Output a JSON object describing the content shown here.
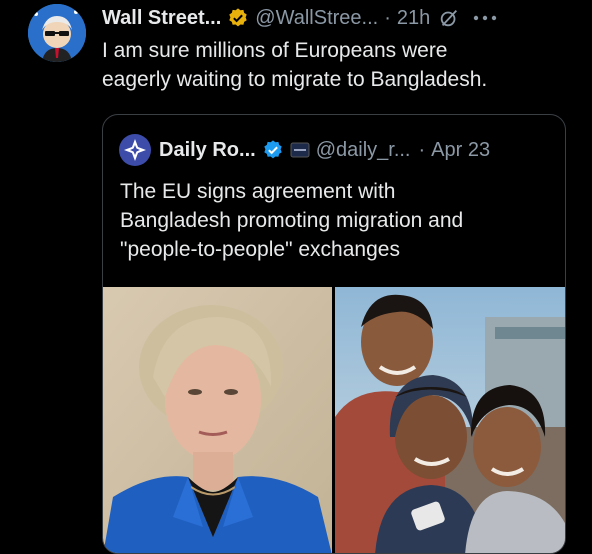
{
  "tweet": {
    "author_name": "Wall Street...",
    "handle": "@WallStree...",
    "separator": "·",
    "time": "21h",
    "text_line1": "I am sure millions of Europeans were",
    "text_line2": "eagerly waiting to migrate to Bangladesh."
  },
  "quote": {
    "author_name": "Daily Ro...",
    "handle": "@daily_r...",
    "separator": "·",
    "date": "Apr 23",
    "text_line1": "The EU signs agreement with",
    "text_line2": "Bangladesh promoting migration and",
    "text_line3": "\"people-to-people\" exchanges"
  },
  "colors": {
    "background": "#000000",
    "text": "#e7e9ea",
    "muted": "#8b98a5",
    "gold_badge": "#e8b10b",
    "blue_badge": "#1d9bf0"
  }
}
